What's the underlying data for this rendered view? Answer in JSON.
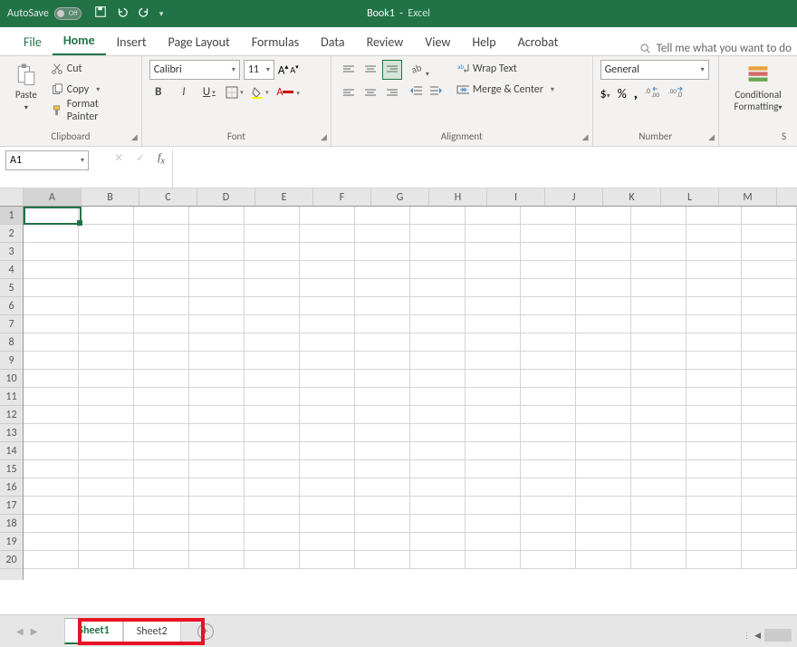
{
  "titlebar": {
    "autosave_label": "AutoSave",
    "autosave_state": "Off",
    "doc_name": "Book1",
    "app_name": "Excel"
  },
  "tabs": {
    "file": "File",
    "home": "Home",
    "insert": "Insert",
    "page_layout": "Page Layout",
    "formulas": "Formulas",
    "data": "Data",
    "review": "Review",
    "view": "View",
    "help": "Help",
    "acrobat": "Acrobat",
    "tellme": "Tell me what you want to do"
  },
  "ribbon": {
    "clipboard": {
      "label": "Clipboard",
      "paste": "Paste",
      "cut": "Cut",
      "copy": "Copy",
      "format_painter": "Format Painter"
    },
    "font": {
      "label": "Font",
      "name": "Calibri",
      "size": "11",
      "bold": "B",
      "italic": "I",
      "underline": "U"
    },
    "alignment": {
      "label": "Alignment",
      "wrap_text": "Wrap Text",
      "merge_center": "Merge & Center"
    },
    "number": {
      "label": "Number",
      "format": "General"
    },
    "styles": {
      "conditional": "Conditional Formatting"
    }
  },
  "namebox": {
    "value": "A1"
  },
  "columns": [
    "A",
    "B",
    "C",
    "D",
    "E",
    "F",
    "G",
    "H",
    "I",
    "J",
    "K",
    "L",
    "M"
  ],
  "rows": [
    "1",
    "2",
    "3",
    "4",
    "5",
    "6",
    "7",
    "8",
    "9",
    "10",
    "11",
    "12",
    "13",
    "14",
    "15",
    "16",
    "17",
    "18",
    "19",
    "20"
  ],
  "sheets": {
    "sheet1": "Sheet1",
    "sheet2": "Sheet2"
  }
}
